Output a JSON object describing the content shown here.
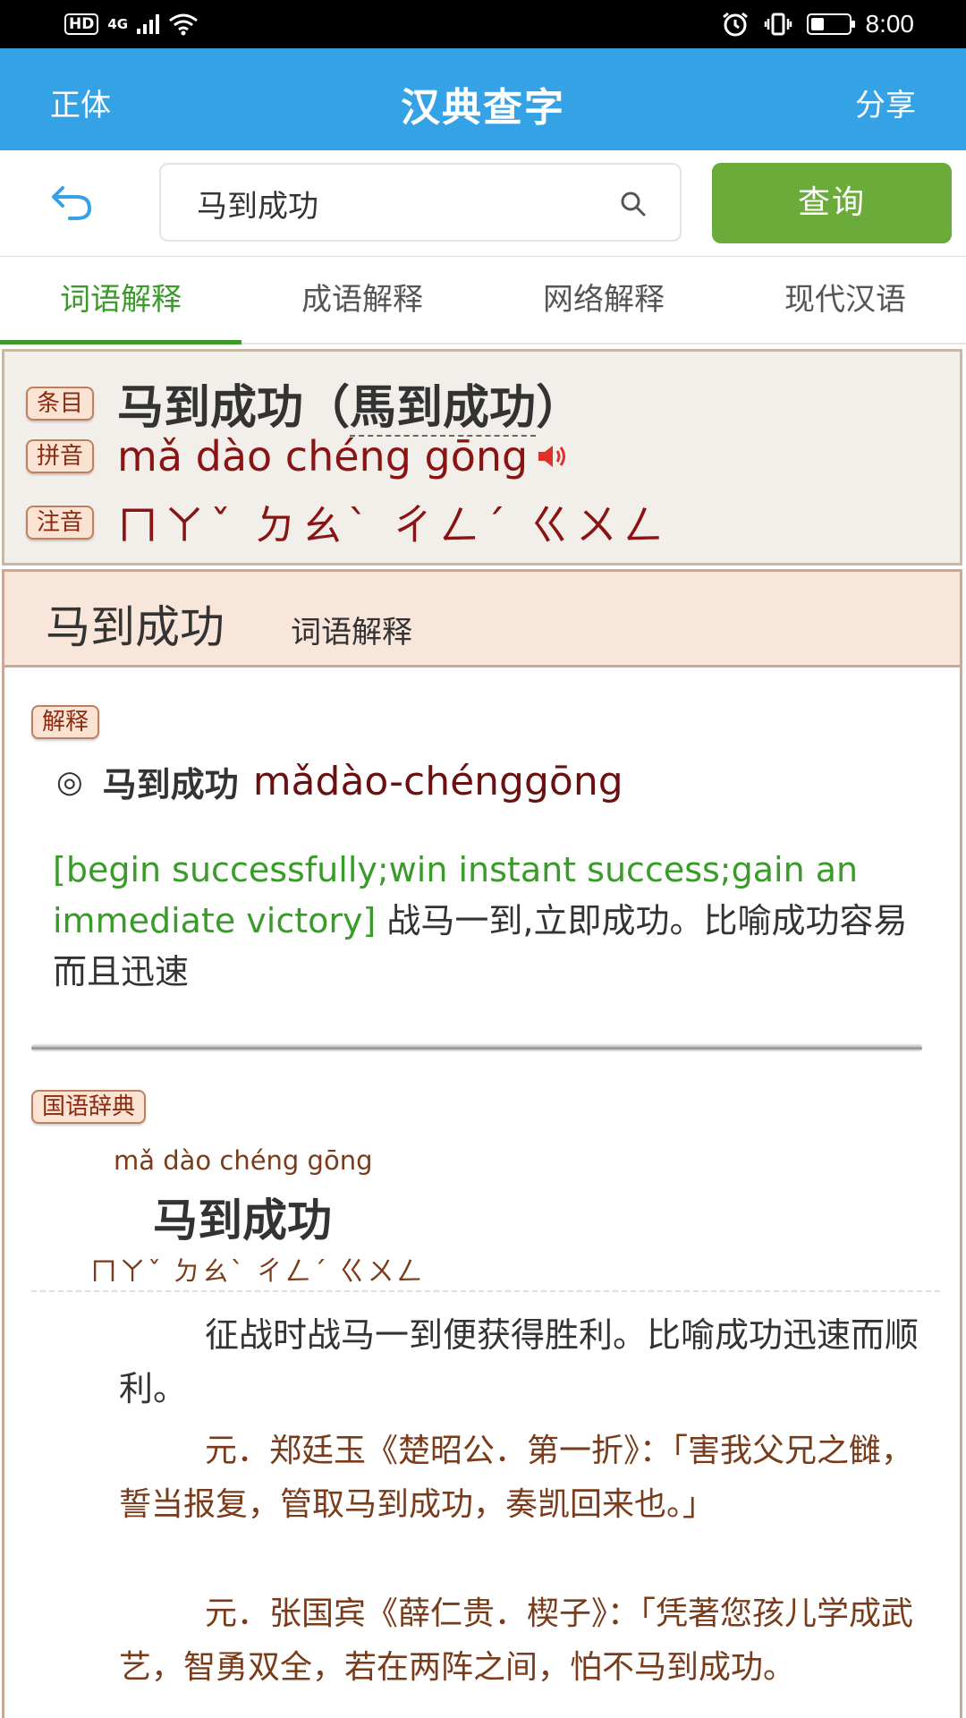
{
  "status_bar": {
    "hd": "HD",
    "network": "4G",
    "time": "8:00",
    "battery_level": 0.35
  },
  "app_bar": {
    "left": "正体",
    "title": "汉典查字",
    "right": "分享"
  },
  "search": {
    "value": "马到成功",
    "button": "查询"
  },
  "tabs": [
    "词语解释",
    "成语解释",
    "网络解释",
    "现代汉语"
  ],
  "entry": {
    "badge_entry": "条目",
    "badge_pinyin": "拼音",
    "badge_zhuyin": "注音",
    "title_simplified": "马到成功",
    "paren_open": "（",
    "title_traditional": "馬到成功",
    "paren_close": "）",
    "pinyin": "mǎ dào chéng gōng",
    "zhuyin": "ㄇㄚˇ ㄉㄠˋ ㄔㄥˊ ㄍㄨㄥ"
  },
  "section": {
    "word": "马到成功",
    "label": "词语解释"
  },
  "explanation": {
    "badge": "解释",
    "marker": "◎",
    "word": "马到成功",
    "pinyin": "mǎdào-chénggōng",
    "english": "[begin successfully;win instant success;gain an immediate victory]",
    "chinese": "战马一到,立即成功。比喻成功容易而且迅速"
  },
  "guoyu": {
    "badge": "国语辞典",
    "pinyin": "mǎ dào chéng gōng",
    "word": "马到成功",
    "zhuyin": "ㄇㄚˇ ㄉㄠˋ ㄔㄥˊ ㄍㄨㄥ",
    "definition": "征战时战马一到便获得胜利。比喻成功迅速而顺利。",
    "example1": "元．郑廷玉《楚昭公．第一折》：「害我父兄之雠，誓当报复，管取马到成功，奏凯回来也。」",
    "example2": "元．张国宾《薛仁贵．楔子》：「凭著您孩儿学成武艺，智勇双全，若在两阵之间，怕不马到成功。"
  }
}
